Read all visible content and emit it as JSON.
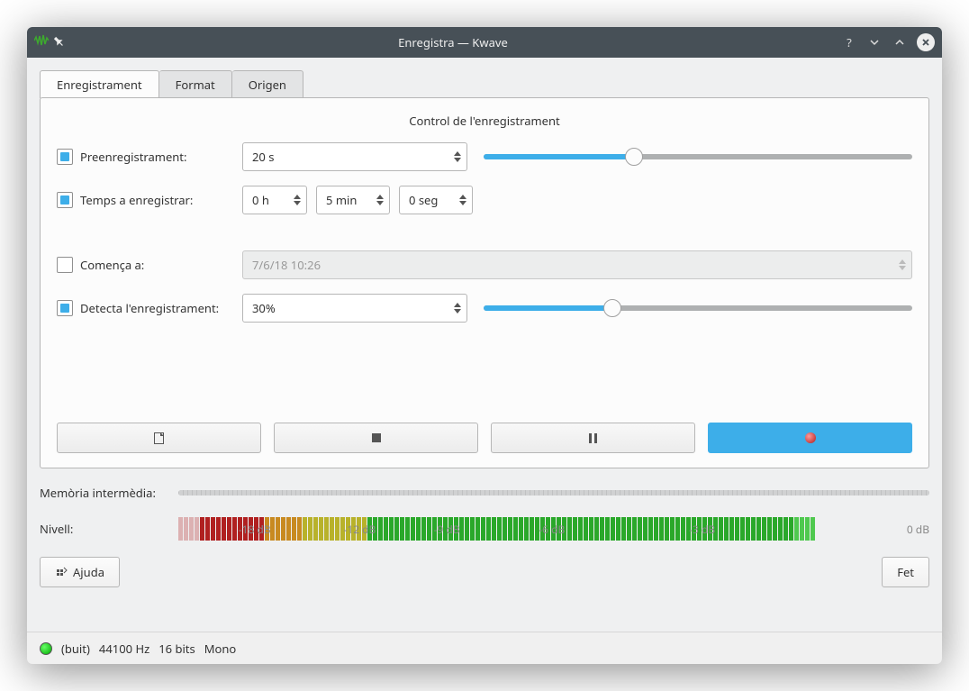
{
  "window_title": "Enregistra — Kwave",
  "tabs": {
    "recording": "Enregistrament",
    "format": "Format",
    "source": "Origen",
    "active": 0
  },
  "groupbox_title": "Control de l'enregistrament",
  "rows": {
    "prerecord": {
      "label": "Preenregistrament:",
      "checked": true,
      "value": "20 s",
      "slider_percent": 35
    },
    "record_time": {
      "label": "Temps a enregistrar:",
      "checked": true,
      "h": "0 h",
      "m": "5 min",
      "s": "0 seg"
    },
    "start_at": {
      "label": "Comença a:",
      "checked": false,
      "value": "7/6/18 10:26"
    },
    "detect": {
      "label": "Detecta l'enregistrament:",
      "checked": true,
      "value": "30%",
      "slider_percent": 30
    }
  },
  "buffer_label": "Memòria intermèdia:",
  "level_label": "Nivell:",
  "level_ticks": [
    "-18 dB",
    "-12 dB",
    "-9 dB",
    "-6 dB",
    "-3 dB",
    "0 dB"
  ],
  "buttons": {
    "help": "Ajuda",
    "done": "Fet"
  },
  "status": {
    "empty": "(buit)",
    "rate": "44100 Hz",
    "bits": "16 bits",
    "channels": "Mono"
  }
}
